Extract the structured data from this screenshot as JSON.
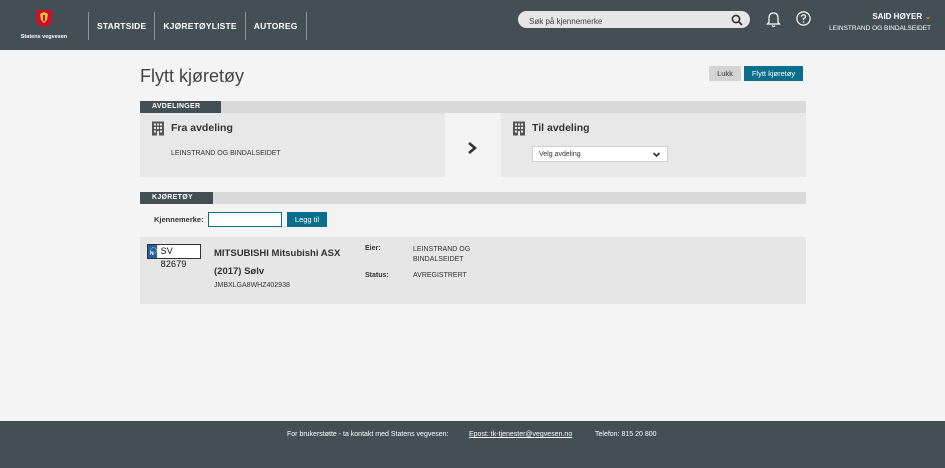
{
  "header": {
    "logo_text": "Statens vegvesen",
    "nav": [
      "STARTSIDE",
      "KJØRETØYLISTE",
      "AUTOREG"
    ],
    "search_placeholder": "Søk på kjennemerke",
    "user_name": "SAID HØYER",
    "user_caret": "⌄",
    "user_org": "LEINSTRAND OG BINDALSEIDET"
  },
  "page": {
    "title": "Flytt kjøretøy",
    "close_label": "Lukk",
    "move_label": "Flytt kjøretøy"
  },
  "departments": {
    "section_label": "AVDELINGER",
    "from_title": "Fra avdeling",
    "from_value": "LEINSTRAND OG BINDALSEIDET",
    "to_title": "Til avdeling",
    "to_select": "Velg avdeling"
  },
  "vehicles": {
    "section_label": "KJØRETØY",
    "reg_label": "Kjennemerke:",
    "reg_value": "",
    "add_label": "Legg til",
    "item": {
      "plate": "SV 82679",
      "name": "MITSUBISHI Mitsubishi ASX (2017) Sølv",
      "vin": "JMBXLGA8WHZ402938",
      "owner_label": "Eier:",
      "owner_value": "LEINSTRAND OG BINDALSEIDET",
      "status_label": "Status:",
      "status_value": "AVREGISTRERT"
    }
  },
  "footer": {
    "support": "For brukerstøtte - ta kontakt med Statens vegvesen:",
    "email": "Epost: tk-tjenester@vegvesen.no",
    "phone": "Telefon: 815 20 800"
  },
  "colors": {
    "header_bg": "#444f55",
    "accent": "#0b6f8c",
    "brand_red": "#c8102e",
    "brand_yellow": "#e0a020"
  },
  "icons": [
    "crest-logo",
    "search-icon",
    "bell-icon",
    "help-icon",
    "building-icon",
    "chevron-right-icon",
    "chevron-down-icon"
  ]
}
